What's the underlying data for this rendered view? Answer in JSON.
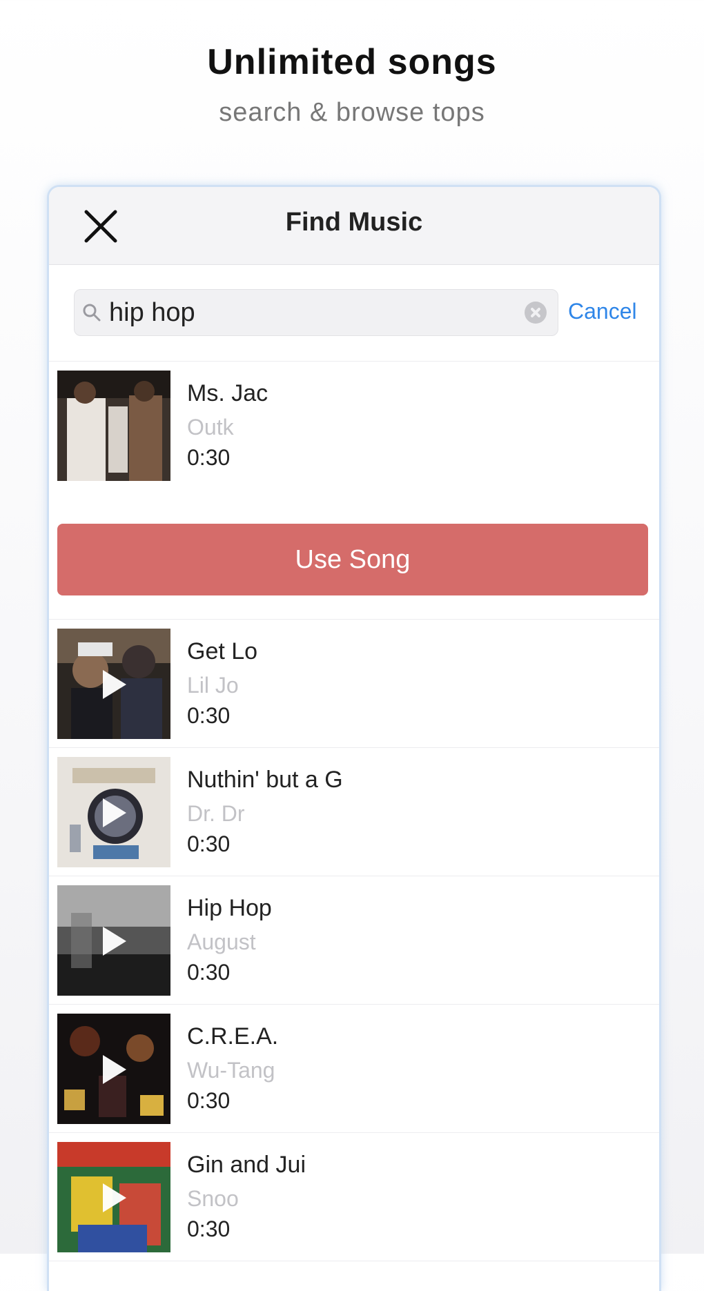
{
  "hero": {
    "title": "Unlimited songs",
    "subtitle": "search & browse tops"
  },
  "modal": {
    "title": "Find Music",
    "close_icon": "close-icon"
  },
  "search": {
    "value": "hip hop",
    "cancel_label": "Cancel",
    "icon": "search-icon",
    "clear_icon": "clear-icon"
  },
  "selected": {
    "title": "Ms. Jac",
    "artist": "Outk",
    "duration": "0:30",
    "use_label": "Use Song"
  },
  "tracks": [
    {
      "title": "Get Lo",
      "artist": "Lil Jo",
      "duration": "0:30"
    },
    {
      "title": "Nuthin' but a G",
      "artist": "Dr. Dr",
      "duration": "0:30"
    },
    {
      "title": "Hip Hop",
      "artist": "August",
      "duration": "0:30"
    },
    {
      "title": "C.R.E.A.",
      "artist": "Wu-Tang",
      "duration": "0:30"
    },
    {
      "title": "Gin and Jui",
      "artist": "Snoo",
      "duration": "0:30"
    }
  ],
  "colors": {
    "accent_red": "#d56c6a",
    "link_blue": "#2f86e8",
    "phone_border": "#cfe0f4"
  }
}
